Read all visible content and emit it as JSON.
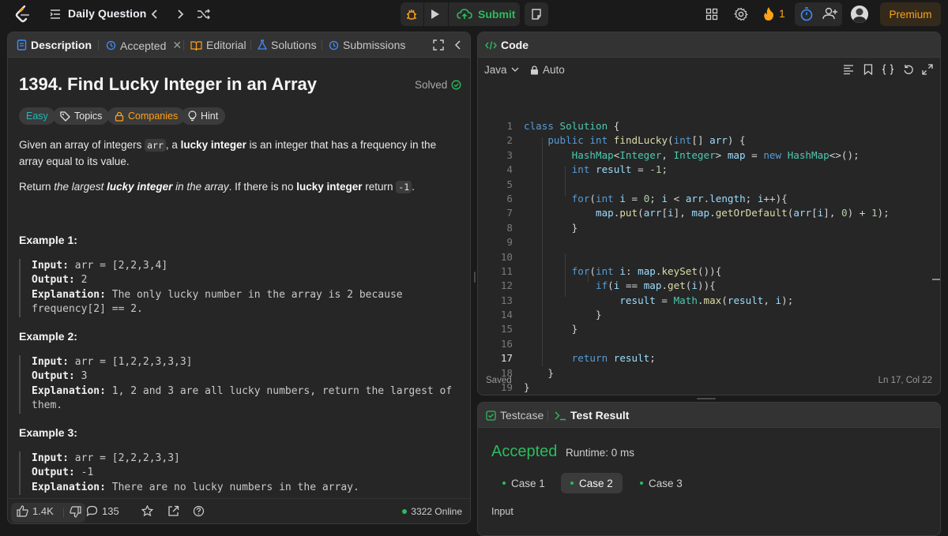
{
  "topbar": {
    "title": "Daily Question",
    "submit_label": "Submit",
    "streak_count": "1",
    "premium_label": "Premium"
  },
  "left_panel": {
    "tabs": [
      {
        "label": "Description"
      },
      {
        "label": "Accepted"
      },
      {
        "label": "Editorial"
      },
      {
        "label": "Solutions"
      },
      {
        "label": "Submissions"
      }
    ],
    "problem_title": "1394. Find Lucky Integer in an Array",
    "solved_label": "Solved",
    "chips": {
      "difficulty": "Easy",
      "topics": "Topics",
      "companies": "Companies",
      "hint": "Hint"
    },
    "description": {
      "p1_a": "Given an array of integers ",
      "p1_code": "arr",
      "p1_b": ", a ",
      "p1_bold": "lucky integer",
      "p1_c": " is an integer that has a frequency in the array equal to its value.",
      "p2_a": "Return ",
      "p2_it1": "the largest ",
      "p2_bold": "lucky integer",
      "p2_it2": " in the array",
      "p2_b": ". If there is no ",
      "p2_bold2": "lucky integer",
      "p2_c": " return ",
      "p2_code": "-1",
      "p2_d": "."
    },
    "examples": [
      {
        "heading": "Example 1:",
        "input_label": "Input:",
        "input": " arr = [2,2,3,4]",
        "output_label": "Output:",
        "output": " 2",
        "explanation_label": "Explanation:",
        "explanation": " The only lucky number in the array is 2 because frequency[2] == 2."
      },
      {
        "heading": "Example 2:",
        "input_label": "Input:",
        "input": " arr = [1,2,2,3,3,3]",
        "output_label": "Output:",
        "output": " 3",
        "explanation_label": "Explanation:",
        "explanation": " 1, 2 and 3 are all lucky numbers, return the largest of them."
      },
      {
        "heading": "Example 3:",
        "input_label": "Input:",
        "input": " arr = [2,2,2,3,3]",
        "output_label": "Output:",
        "output": " -1",
        "explanation_label": "Explanation:",
        "explanation": " There are no lucky numbers in the array."
      }
    ],
    "footer": {
      "likes": "1.4K",
      "comments": "135",
      "online": "3322 Online"
    }
  },
  "code_panel": {
    "title": "Code",
    "language": "Java",
    "mode": "Auto",
    "lines": [
      {
        "n": "1",
        "html": "<span class='kw'>class</span> <span class='ty'>Solution</span> {"
      },
      {
        "n": "2",
        "html": "    <span class='kw'>public</span> <span class='kw'>int</span> <span class='fn'>findLucky</span>(<span class='kw'>int</span>[] <span class='vr'>arr</span>) {"
      },
      {
        "n": "3",
        "html": "        <span class='ty'>HashMap</span>&lt;<span class='ty'>Integer</span>, <span class='ty'>Integer</span>&gt; <span class='vr'>map</span> = <span class='kw'>new</span> <span class='ty'>HashMap</span>&lt;&gt;();"
      },
      {
        "n": "4",
        "html": "        <span class='kw'>int</span> <span class='vr'>result</span> = <span class='num'>-1</span>;"
      },
      {
        "n": "5",
        "html": ""
      },
      {
        "n": "6",
        "html": "        <span class='kw'>for</span>(<span class='kw'>int</span> <span class='vr'>i</span> = <span class='num'>0</span>; <span class='vr'>i</span> &lt; <span class='vr'>arr</span>.<span class='vr'>length</span>; <span class='vr'>i</span>++){"
      },
      {
        "n": "7",
        "html": "            <span class='vr'>map</span>.<span class='fn'>put</span>(<span class='vr'>arr</span>[<span class='vr'>i</span>], <span class='vr'>map</span>.<span class='fn'>getOrDefault</span>(<span class='vr'>arr</span>[<span class='vr'>i</span>], <span class='num'>0</span>) + <span class='num'>1</span>);"
      },
      {
        "n": "8",
        "html": "        }"
      },
      {
        "n": "9",
        "html": ""
      },
      {
        "n": "10",
        "html": ""
      },
      {
        "n": "11",
        "html": "        <span class='kw'>for</span>(<span class='kw'>int</span> <span class='vr'>i</span>: <span class='vr'>map</span>.<span class='fn'>keySet</span>()){"
      },
      {
        "n": "12",
        "html": "            <span class='kw'>if</span>(<span class='vr'>i</span> == <span class='vr'>map</span>.<span class='fn'>get</span>(<span class='vr'>i</span>)){"
      },
      {
        "n": "13",
        "html": "                <span class='vr'>result</span> = <span class='ty'>Math</span>.<span class='fn'>max</span>(<span class='vr'>result</span>, <span class='vr'>i</span>);"
      },
      {
        "n": "14",
        "html": "            }"
      },
      {
        "n": "15",
        "html": "        }"
      },
      {
        "n": "16",
        "html": ""
      },
      {
        "n": "17",
        "html": "        <span class='kw'>return</span> <span class='vr'>result</span>;"
      },
      {
        "n": "18",
        "html": "    }"
      },
      {
        "n": "19",
        "html": "}"
      }
    ],
    "current_line": "17",
    "status": "Saved",
    "cursor": "Ln 17, Col 22"
  },
  "result_panel": {
    "tabs": [
      {
        "label": "Testcase"
      },
      {
        "label": "Test Result"
      }
    ],
    "verdict": "Accepted",
    "runtime": "Runtime: 0 ms",
    "cases": [
      {
        "label": "Case 1"
      },
      {
        "label": "Case 2"
      },
      {
        "label": "Case 3"
      }
    ],
    "active_case": "Case 2",
    "input_label": "Input"
  },
  "colors": {
    "accent_orange": "#ffa116",
    "accepted_green": "#2cbb5d",
    "panel": "#262626",
    "header": "#333333"
  }
}
